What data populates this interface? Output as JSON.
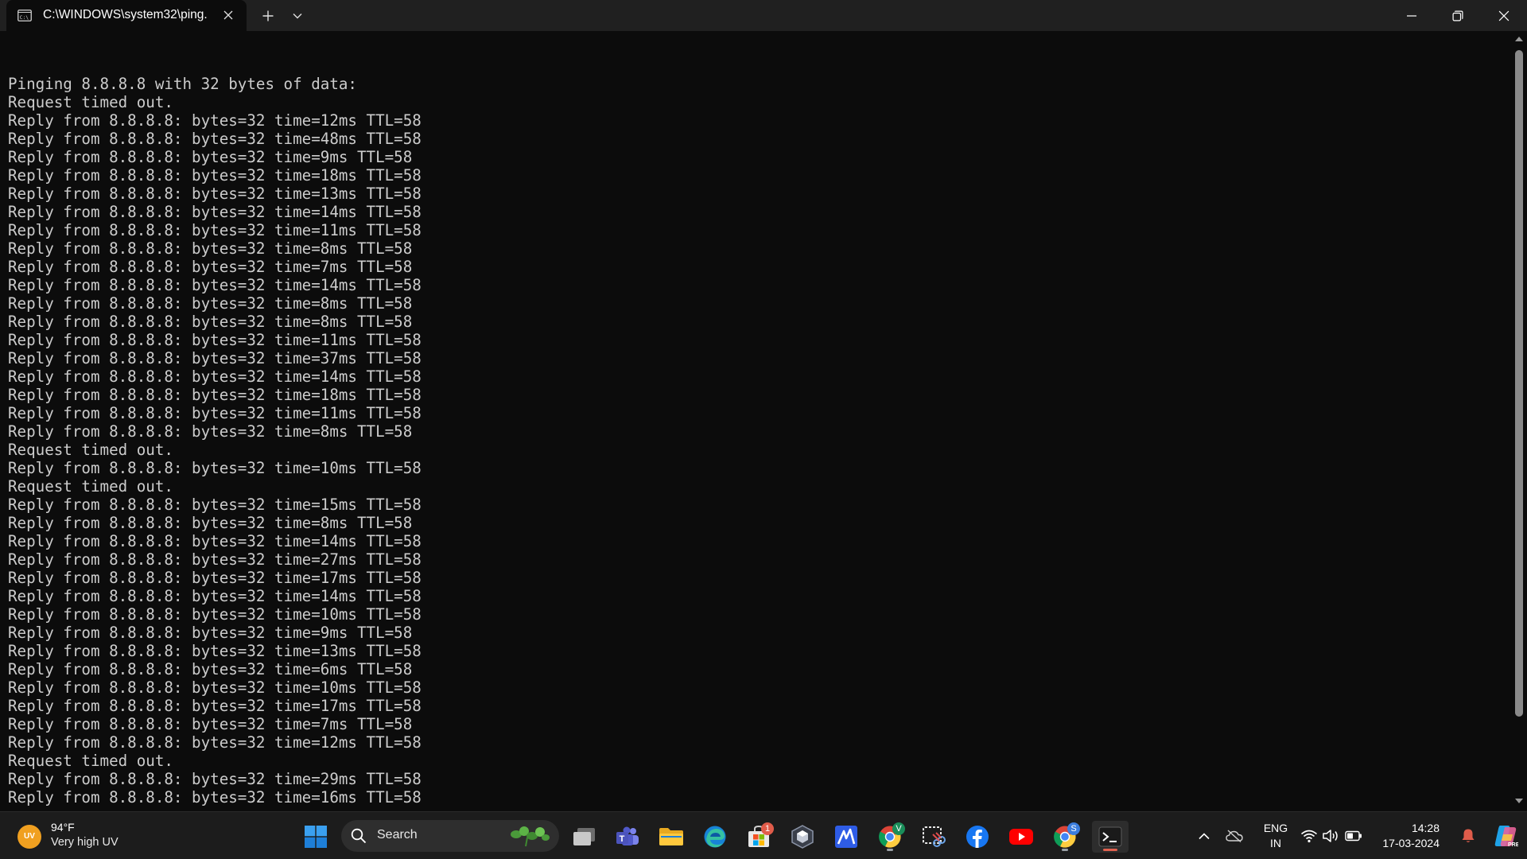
{
  "window": {
    "tab_title": "C:\\WINDOWS\\system32\\ping.",
    "tab_icon": "terminal-icon",
    "buttons": {
      "minimize": "minimize-icon",
      "restore": "restore-icon",
      "close": "close-icon"
    }
  },
  "console": {
    "lines": [
      "",
      "Pinging 8.8.8.8 with 32 bytes of data:",
      "Request timed out.",
      "Reply from 8.8.8.8: bytes=32 time=12ms TTL=58",
      "Reply from 8.8.8.8: bytes=32 time=48ms TTL=58",
      "Reply from 8.8.8.8: bytes=32 time=9ms TTL=58",
      "Reply from 8.8.8.8: bytes=32 time=18ms TTL=58",
      "Reply from 8.8.8.8: bytes=32 time=13ms TTL=58",
      "Reply from 8.8.8.8: bytes=32 time=14ms TTL=58",
      "Reply from 8.8.8.8: bytes=32 time=11ms TTL=58",
      "Reply from 8.8.8.8: bytes=32 time=8ms TTL=58",
      "Reply from 8.8.8.8: bytes=32 time=7ms TTL=58",
      "Reply from 8.8.8.8: bytes=32 time=14ms TTL=58",
      "Reply from 8.8.8.8: bytes=32 time=8ms TTL=58",
      "Reply from 8.8.8.8: bytes=32 time=8ms TTL=58",
      "Reply from 8.8.8.8: bytes=32 time=11ms TTL=58",
      "Reply from 8.8.8.8: bytes=32 time=37ms TTL=58",
      "Reply from 8.8.8.8: bytes=32 time=14ms TTL=58",
      "Reply from 8.8.8.8: bytes=32 time=18ms TTL=58",
      "Reply from 8.8.8.8: bytes=32 time=11ms TTL=58",
      "Reply from 8.8.8.8: bytes=32 time=8ms TTL=58",
      "Request timed out.",
      "Reply from 8.8.8.8: bytes=32 time=10ms TTL=58",
      "Request timed out.",
      "Reply from 8.8.8.8: bytes=32 time=15ms TTL=58",
      "Reply from 8.8.8.8: bytes=32 time=8ms TTL=58",
      "Reply from 8.8.8.8: bytes=32 time=14ms TTL=58",
      "Reply from 8.8.8.8: bytes=32 time=27ms TTL=58",
      "Reply from 8.8.8.8: bytes=32 time=17ms TTL=58",
      "Reply from 8.8.8.8: bytes=32 time=14ms TTL=58",
      "Reply from 8.8.8.8: bytes=32 time=10ms TTL=58",
      "Reply from 8.8.8.8: bytes=32 time=9ms TTL=58",
      "Reply from 8.8.8.8: bytes=32 time=13ms TTL=58",
      "Reply from 8.8.8.8: bytes=32 time=6ms TTL=58",
      "Reply from 8.8.8.8: bytes=32 time=10ms TTL=58",
      "Reply from 8.8.8.8: bytes=32 time=17ms TTL=58",
      "Reply from 8.8.8.8: bytes=32 time=7ms TTL=58",
      "Reply from 8.8.8.8: bytes=32 time=12ms TTL=58",
      "Request timed out.",
      "Reply from 8.8.8.8: bytes=32 time=29ms TTL=58",
      "Reply from 8.8.8.8: bytes=32 time=16ms TTL=58"
    ]
  },
  "taskbar": {
    "weather": {
      "icon_text": "UV",
      "temp": "94°F",
      "desc": "Very high UV"
    },
    "search_label": "Search",
    "apps": [
      {
        "name": "task-view",
        "icon": "task-view-icon"
      },
      {
        "name": "teams",
        "icon": "teams-icon"
      },
      {
        "name": "file-explorer",
        "icon": "folder-icon"
      },
      {
        "name": "edge",
        "icon": "edge-icon"
      },
      {
        "name": "microsoft-store",
        "icon": "store-icon",
        "badge": "1"
      },
      {
        "name": "app-dark-hexagon",
        "icon": "hexagon-icon"
      },
      {
        "name": "app-blue-m",
        "icon": "m-app-icon"
      },
      {
        "name": "chrome-profile-v",
        "icon": "chrome-icon",
        "badge": "V"
      },
      {
        "name": "snipping-tool",
        "icon": "snipping-tool-icon"
      },
      {
        "name": "facebook",
        "icon": "facebook-icon"
      },
      {
        "name": "youtube",
        "icon": "youtube-icon"
      },
      {
        "name": "chrome-profile-s",
        "icon": "chrome-icon",
        "badge": "S"
      },
      {
        "name": "terminal",
        "icon": "terminal-icon"
      }
    ],
    "tray": {
      "lang_line1": "ENG",
      "lang_line2": "IN",
      "time": "14:28",
      "date": "17-03-2024"
    }
  },
  "colors": {
    "console_bg": "#0c0c0c",
    "console_text": "#cccccc",
    "titlebar_bg": "#202020",
    "taskbar_bg": "#1c1c1c",
    "active_indicator": "#e0614f"
  }
}
